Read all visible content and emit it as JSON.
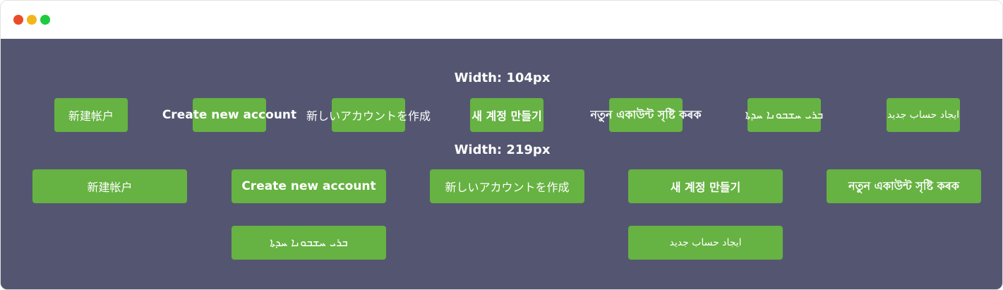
{
  "window": {
    "controls": [
      "close",
      "minimize",
      "maximize"
    ]
  },
  "colors": {
    "canvas_background": "#545671",
    "button_background": "#66b242",
    "button_text": "#ffffff"
  },
  "sections": [
    {
      "title": "Width: 104px",
      "buttons": [
        "新建帐户",
        "Create new account",
        "新しいアカウントを作成",
        "새 계정 만들기",
        "নতুন একাউন্ট সৃষ্টি কৰক",
        "ܒܪܝ ܚܫܒܘܢܐ ܚܕܬܐ",
        "ایجاد حساب جدید"
      ]
    },
    {
      "title": "Width: 219px",
      "buttons": [
        "新建帐户",
        "Create new account",
        "新しいアカウントを作成",
        "새 계정 만들기",
        "নতুন একাউন্ট সৃষ্টি কৰক",
        "ܒܪܝ ܚܫܒܘܢܐ ܚܕܬܐ",
        "ایجاد حساب جدید"
      ]
    }
  ]
}
